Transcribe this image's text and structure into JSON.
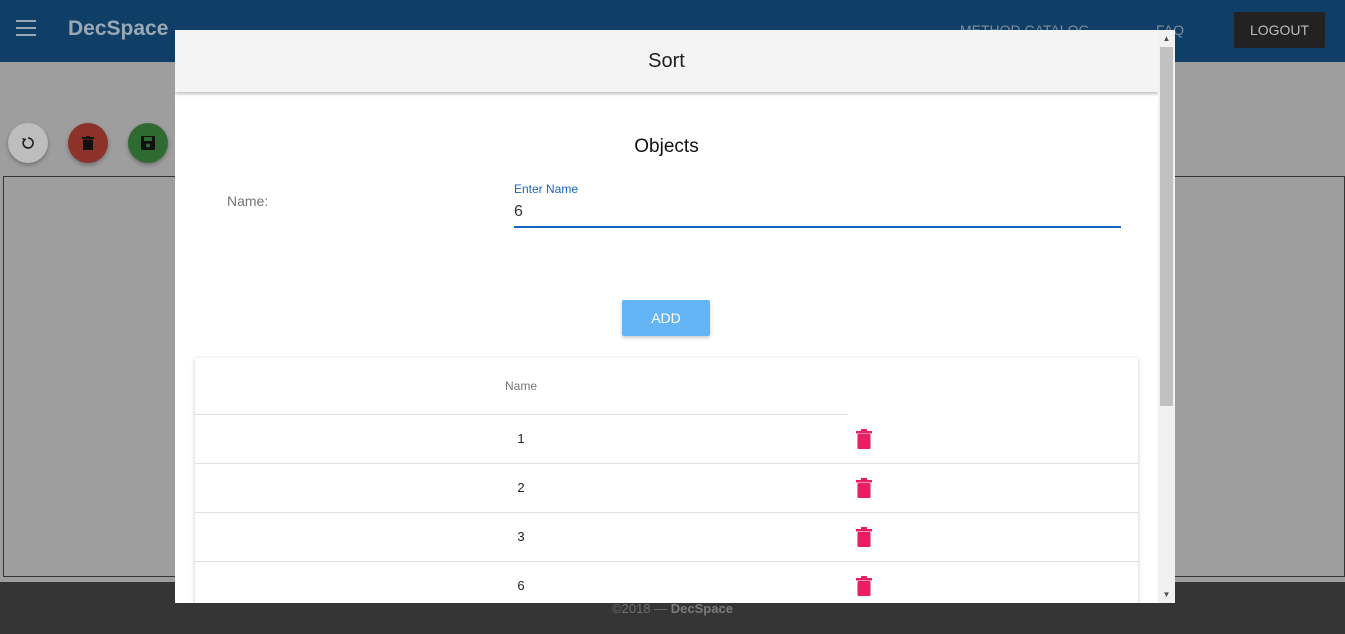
{
  "app": {
    "brand": "DecSpace",
    "nav": {
      "method_catalog": "METHOD CATALOG",
      "faq": "FAQ",
      "logout": "LOGOUT"
    },
    "fabs": [
      {
        "icon": "undo-icon",
        "color": "#bdbdbd"
      },
      {
        "icon": "trash-icon",
        "color": "#8c3229"
      },
      {
        "icon": "save-icon",
        "color": "#2f6a31"
      }
    ],
    "footer": {
      "copyright": "©2018 — ",
      "brand": "DecSpace"
    }
  },
  "modal": {
    "title": "Sort",
    "section_title": "Objects",
    "name_label": "Name:",
    "input": {
      "label": "Enter Name",
      "value": "6"
    },
    "add_button": "ADD",
    "table": {
      "header": "Name",
      "rows": [
        "1",
        "2",
        "3",
        "6"
      ],
      "delete_icon_color": "#e91e63"
    }
  }
}
